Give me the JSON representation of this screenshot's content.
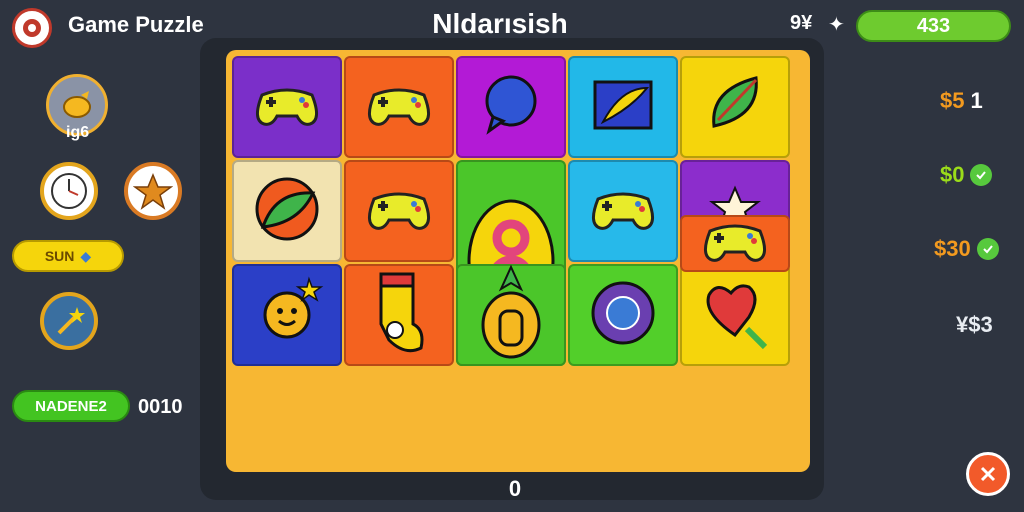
{
  "header": {
    "app_title": "Game Puzzle",
    "game_title": "Nldarısish",
    "stat_label": "9¥",
    "score": "433"
  },
  "left_panel": {
    "top_item_label": "ig6",
    "sun_button_label": "SUN",
    "mode_button_label": "NADENE2",
    "mode_value": "0010"
  },
  "right_panel": {
    "values": [
      "$5",
      "$0",
      "$30",
      "¥$3"
    ],
    "value_suffix": "1"
  },
  "board": {
    "counter": "0",
    "tiles": [
      {
        "icon": "gamepad-icon",
        "bg": "#7b2fc9"
      },
      {
        "icon": "gamepad-icon",
        "bg": "#f4621f"
      },
      {
        "icon": "speech-bubble-icon",
        "bg": "#b31ad6"
      },
      {
        "icon": "feather-card-icon",
        "bg": "#22b8e8"
      },
      {
        "icon": "leaf-brush-icon",
        "bg": "#f5d50c"
      },
      {
        "icon": "leaf-sun-icon",
        "bg": "#f2e3b0"
      },
      {
        "icon": "gamepad-icon",
        "bg": "#f4621f"
      },
      {
        "icon": "eight-ring-icon",
        "bg": "#4bc62a"
      },
      {
        "icon": "gamepad-icon",
        "bg": "#27b9ea"
      },
      {
        "icon": "star-cloud-icon",
        "bg": "#8c2dcc"
      },
      {
        "icon": "sun-face-icon",
        "bg": "#2b3fc7"
      },
      {
        "icon": "sock-icon",
        "bg": "#f4621f"
      },
      {
        "icon": "pineapple-icon",
        "bg": "#4bc62a"
      },
      {
        "icon": "gem-badge-icon",
        "bg": "#52cf2a"
      },
      {
        "icon": "heart-icon",
        "bg": "#f5d50c"
      },
      {
        "icon": "gamepad-icon",
        "bg": "#f4621f"
      }
    ]
  },
  "colors": {
    "background": "#2e3440",
    "accent_green": "#6ecb2f",
    "accent_yellow": "#f5d50c",
    "close_red": "#f25a2a"
  }
}
